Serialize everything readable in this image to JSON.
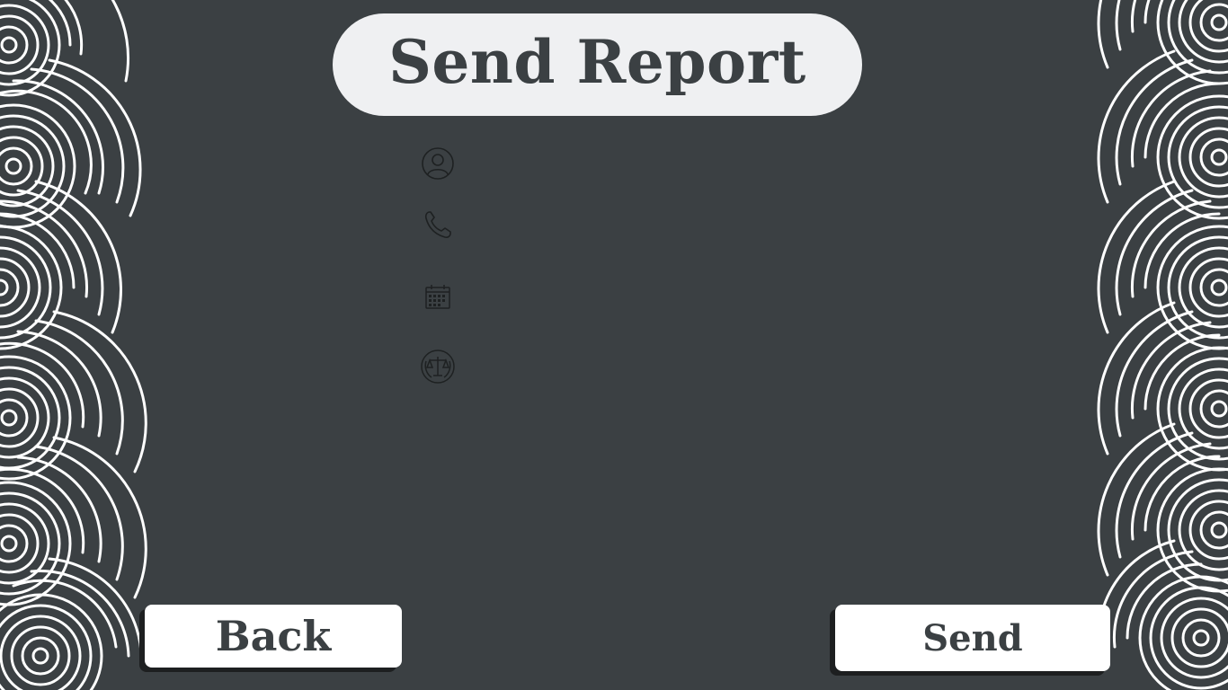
{
  "title": "Send Report",
  "fields": [
    {
      "icon": "user-circle-icon"
    },
    {
      "icon": "phone-icon"
    },
    {
      "icon": "calendar-icon"
    },
    {
      "icon": "scales-of-justice-icon"
    }
  ],
  "buttons": {
    "back_label": "Back",
    "send_label": "Send"
  },
  "colors": {
    "background": "#3b4043",
    "pill": "#eff0f2",
    "button": "#ffffff",
    "text": "#3b4043",
    "decoration": "#ffffff"
  }
}
